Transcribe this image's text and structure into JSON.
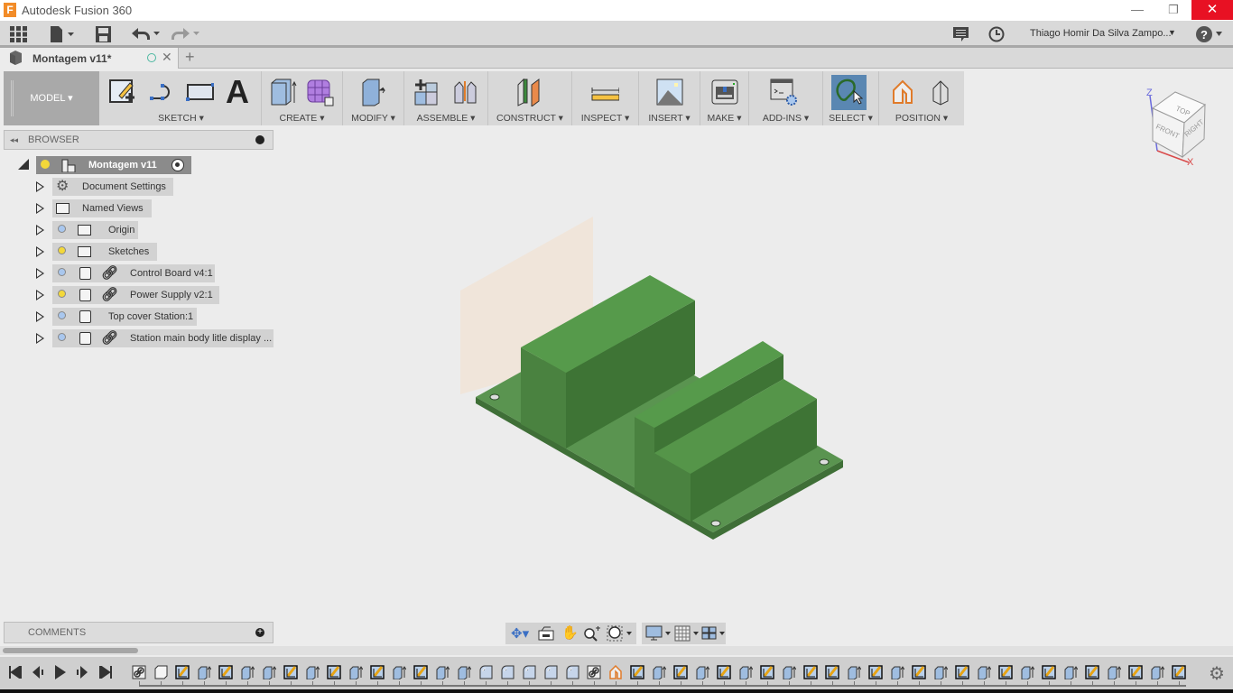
{
  "window": {
    "title": "Autodesk Fusion 360"
  },
  "appbar": {
    "user": "Thiago Homir Da Silva Zampo..."
  },
  "tab": {
    "label": "Montagem v11*"
  },
  "toolbar": {
    "workspace": "MODEL ▾",
    "groups": [
      {
        "label": "SKETCH ▾"
      },
      {
        "label": "CREATE ▾"
      },
      {
        "label": "MODIFY ▾"
      },
      {
        "label": "ASSEMBLE ▾"
      },
      {
        "label": "CONSTRUCT ▾"
      },
      {
        "label": "INSPECT ▾"
      },
      {
        "label": "INSERT ▾"
      },
      {
        "label": "MAKE ▾"
      },
      {
        "label": "ADD-INS ▾"
      },
      {
        "label": "SELECT ▾"
      },
      {
        "label": "POSITION ▾"
      }
    ]
  },
  "browser": {
    "title": "BROWSER",
    "root": "Montagem v11",
    "items": [
      {
        "label": "Document Settings",
        "icon": "gear"
      },
      {
        "label": "Named Views",
        "icon": "folder"
      },
      {
        "label": "Origin",
        "icon": "folder",
        "bulb": "off"
      },
      {
        "label": "Sketches",
        "icon": "folder",
        "bulb": "on"
      },
      {
        "label": "Control Board v4:1",
        "icon": "component-link",
        "bulb": "off"
      },
      {
        "label": "Power Supply v2:1",
        "icon": "component-link",
        "bulb": "on"
      },
      {
        "label": "Top cover Station:1",
        "icon": "component",
        "bulb": "off"
      },
      {
        "label": "Station main body litle display ...",
        "icon": "component-link",
        "bulb": "off"
      }
    ]
  },
  "comments": {
    "title": "COMMENTS"
  },
  "viewcube": {
    "top": "TOP",
    "front": "FRONT",
    "right": "RIGHT",
    "z": "Z",
    "x": "X"
  },
  "colors": {
    "model": "#4f8a45",
    "select_active": "#5a87b2",
    "close": "#e81123"
  },
  "timeline": [
    "link",
    "box",
    "sketch",
    "extrude",
    "sketch",
    "extrude",
    "extrude",
    "sketch",
    "extrude",
    "sketch",
    "extrude",
    "sketch",
    "extrude",
    "sketch",
    "extrude",
    "extrude",
    "fillet",
    "fillet",
    "fillet",
    "fillet",
    "fillet",
    "link",
    "position",
    "sketch",
    "extrude",
    "sketch",
    "extrude",
    "sketch",
    "extrude",
    "sketch",
    "extrude",
    "sketch",
    "sketch",
    "extrude",
    "sketch",
    "extrude",
    "sketch",
    "extrude",
    "sketch",
    "extrude",
    "sketch",
    "extrude",
    "sketch",
    "extrude",
    "sketch",
    "extrude",
    "sketch",
    "extrude",
    "sketch"
  ]
}
